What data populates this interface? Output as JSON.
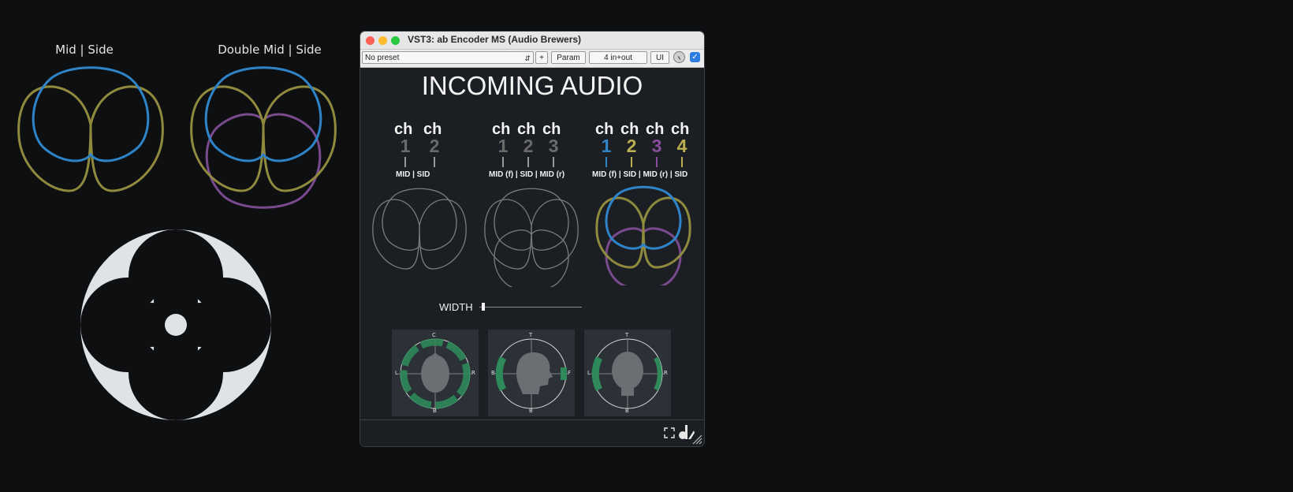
{
  "diagrams": {
    "mid_side_caption": "Mid | Side",
    "double_mid_side_caption": "Double Mid | Side",
    "colors": {
      "mid": "#2f84c8",
      "side": "#8f8a3e",
      "side2": "#7a4a8e",
      "background": "#0e0f11",
      "white_pattern": "#dfe3e8"
    }
  },
  "window": {
    "title": "VST3: ab Encoder MS (Audio Brewers)",
    "toolbar": {
      "preset_value": "No preset",
      "add_label": "+",
      "param_label": "Param",
      "io_label": "4 in+out",
      "ui_label": "UI",
      "bypass_checked": true
    }
  },
  "plugin": {
    "heading": "INCOMING AUDIO",
    "groups": [
      {
        "ch_labels": [
          "ch",
          "ch"
        ],
        "numbers": [
          "1",
          "2"
        ],
        "roles": "MID  |  SID",
        "active": false
      },
      {
        "ch_labels": [
          "ch",
          "ch",
          "ch"
        ],
        "numbers": [
          "1",
          "2",
          "3"
        ],
        "roles": "MID (f) | SID | MID (r)",
        "active": false
      },
      {
        "ch_labels": [
          "ch",
          "ch",
          "ch",
          "ch"
        ],
        "numbers": [
          "1",
          "2",
          "3",
          "4"
        ],
        "roles": "MID (f) | SID | MID (r) | SID",
        "active": true
      }
    ],
    "number_colors_active": [
      "#2f84c8",
      "#b9ae52",
      "#8a4c9c",
      "#b9ae52"
    ],
    "number_color_inactive": "#6a6a6a",
    "width_label": "WIDTH",
    "width_value": 0.02,
    "scopes": [
      {
        "top": "C",
        "left": "L",
        "right": "R",
        "bottom": "B"
      },
      {
        "top": "T",
        "left": "B",
        "right": "F",
        "bottom": "B"
      },
      {
        "top": "T",
        "left": "L",
        "right": "R",
        "bottom": "B"
      }
    ],
    "footer_icons": [
      "fullscreen-icon",
      "audio-brewers-logo-icon",
      "resize-grip-icon"
    ]
  }
}
